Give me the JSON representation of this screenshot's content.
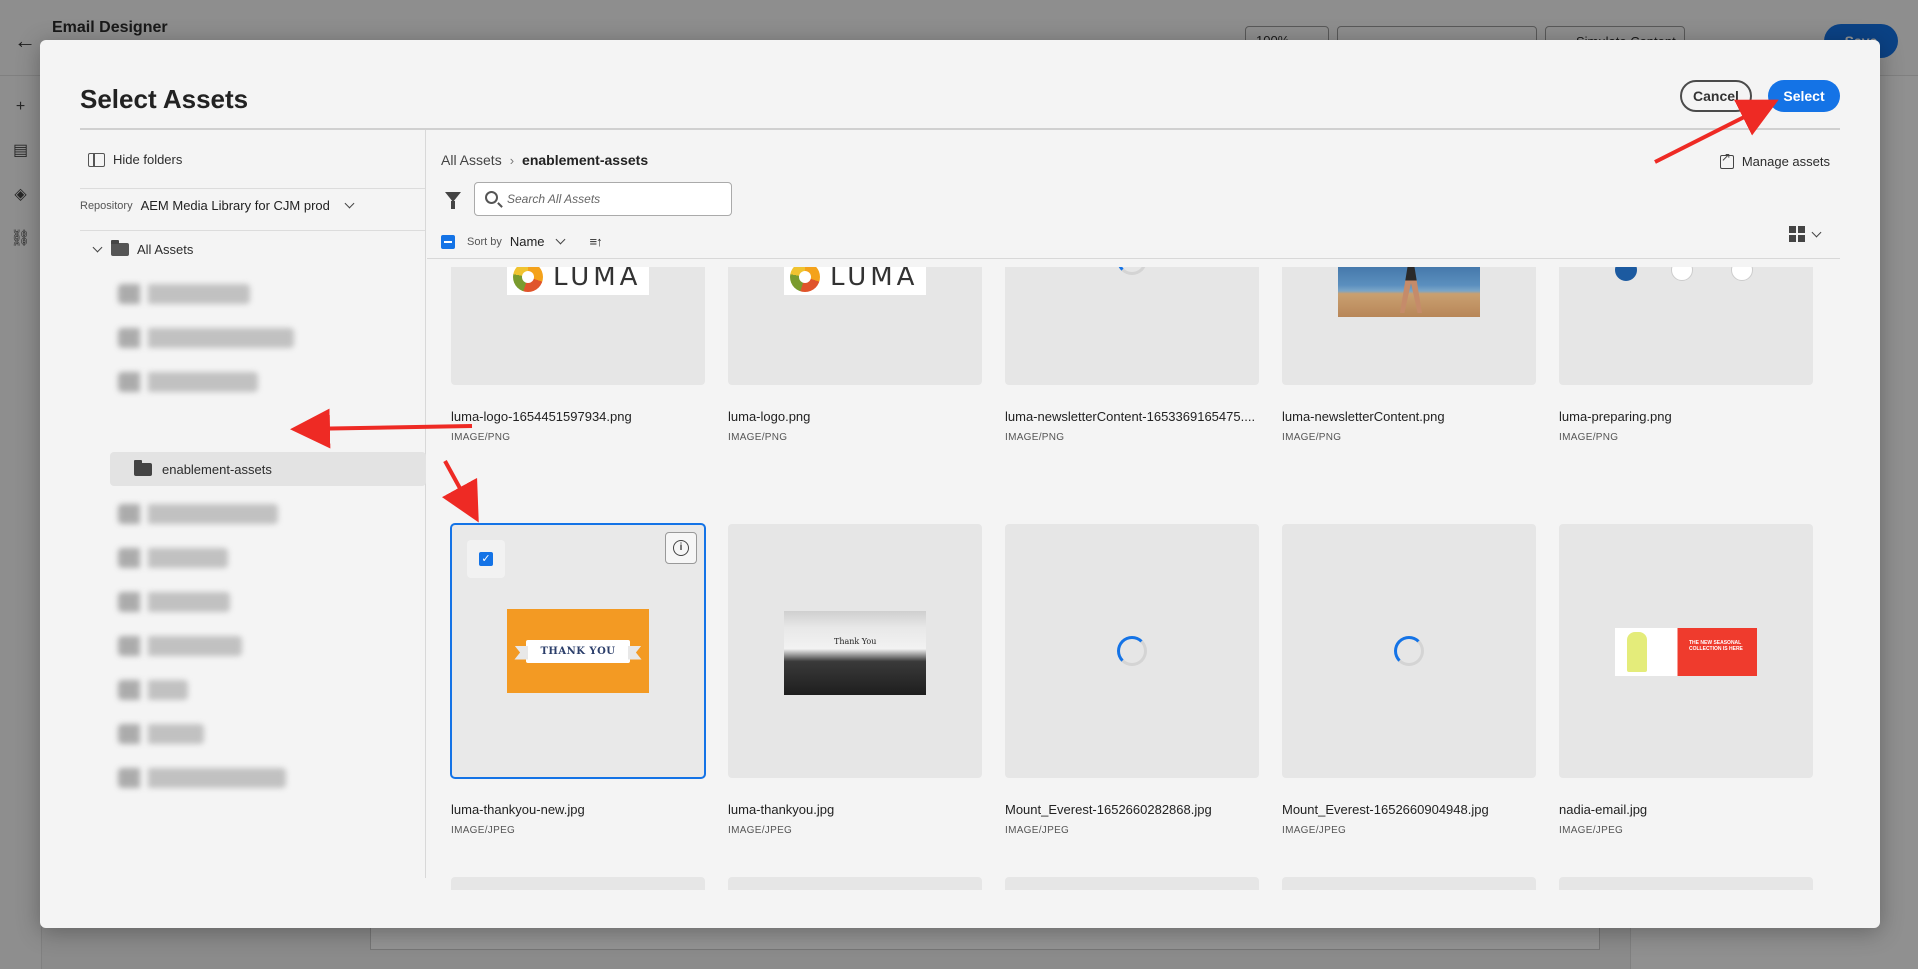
{
  "app": {
    "title": "Email Designer",
    "zoom": "100%",
    "simulate_label": "Simulate Content",
    "save_label": "Save"
  },
  "modal": {
    "title": "Select Assets",
    "cancel_label": "Cancel",
    "select_label": "Select"
  },
  "left_panel": {
    "hide_folders_label": "Hide folders",
    "repository_label": "Repository",
    "repository_value": "AEM Media Library for CJM prod",
    "tree_root_label": "All Assets",
    "selected_folder_label": "enablement-assets"
  },
  "right_panel": {
    "breadcrumb": {
      "root": "All Assets",
      "current": "enablement-assets"
    },
    "manage_assets_label": "Manage assets",
    "search_placeholder": "Search All Assets",
    "sort_by_label": "Sort by",
    "sort_value": "Name"
  },
  "assets": [
    {
      "name": "luma-logo-1654451597934.png",
      "type": "IMAGE/PNG",
      "thumb": "luma-logo"
    },
    {
      "name": "luma-logo.png",
      "type": "IMAGE/PNG",
      "thumb": "luma-logo"
    },
    {
      "name": "luma-newsletterContent-1653369165475....",
      "type": "IMAGE/PNG",
      "thumb": "loading"
    },
    {
      "name": "luma-newsletterContent.png",
      "type": "IMAGE/PNG",
      "thumb": "beach"
    },
    {
      "name": "luma-preparing.png",
      "type": "IMAGE/PNG",
      "thumb": "icons"
    },
    {
      "name": "luma-thankyou-new.jpg",
      "type": "IMAGE/JPEG",
      "thumb": "thankyou",
      "selected": true
    },
    {
      "name": "luma-thankyou.jpg",
      "type": "IMAGE/JPEG",
      "thumb": "typewriter"
    },
    {
      "name": "Mount_Everest-1652660282868.jpg",
      "type": "IMAGE/JPEG",
      "thumb": "loading"
    },
    {
      "name": "Mount_Everest-1652660904948.jpg",
      "type": "IMAGE/JPEG",
      "thumb": "loading"
    },
    {
      "name": "nadia-email.jpg",
      "type": "IMAGE/JPEG",
      "thumb": "banner"
    }
  ],
  "thumb_text": {
    "thankyou": "THANK YOU",
    "typewriter": "Thank You",
    "banner": "THE NEW SEASONAL COLLECTION IS HERE"
  },
  "colors": {
    "accent": "#1473e6",
    "annotation_arrow": "#ee2a24"
  }
}
